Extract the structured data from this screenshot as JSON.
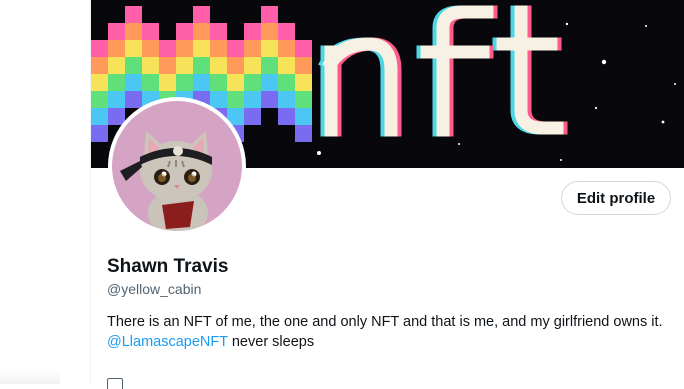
{
  "profile": {
    "banner_text": "nft",
    "display_name": "Shawn Travis",
    "handle": "@yellow_cabin",
    "bio_line1": "There is an NFT of me, the one and only NFT and that is me, and my girlfriend owns it.",
    "bio_mention": "@LlamascapeNFT",
    "bio_tail": " never sleeps",
    "edit_profile_label": "Edit profile"
  },
  "colors": {
    "mention": "#1d9bf0",
    "text_primary": "#0f1419",
    "text_secondary": "#536471",
    "banner_bg": "#08080c",
    "avatar_bg": "#d5a3c4"
  },
  "icons": {
    "avatar": "cat-avatar-icon",
    "meta": "calendar-icon"
  }
}
